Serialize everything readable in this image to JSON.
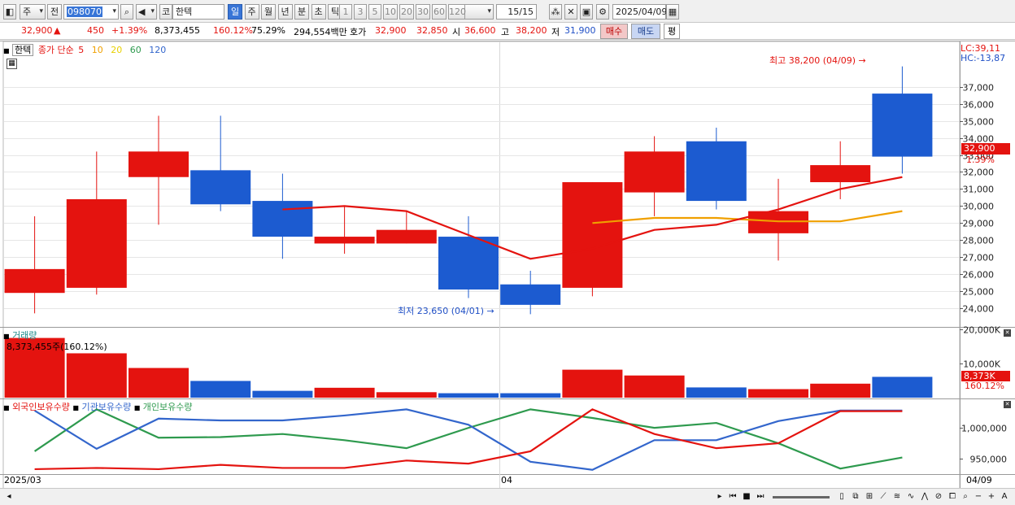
{
  "toolbar": {
    "market_type": "주",
    "prev_label": "전",
    "code": "098070",
    "code_prefix": "코",
    "stock_name": "한텍",
    "periods": [
      "일",
      "주",
      "월",
      "년",
      "분",
      "초",
      "틱"
    ],
    "selected_period": "일",
    "intervals": [
      "1",
      "3",
      "5",
      "10",
      "20",
      "30",
      "60",
      "120"
    ],
    "count": "15/15",
    "date": "2025/04/09"
  },
  "quote": {
    "price": "32,900",
    "change_arrow": "▲",
    "change": "450",
    "change_pct": "+1.39%",
    "volume": "8,373,455",
    "volume_ratio": "160.12%",
    "turnover": "75.29%",
    "amount": "294,554백만",
    "ask_label": "호가",
    "ask": "32,900",
    "bid": "32,850",
    "open_label": "시",
    "open": "36,600",
    "high_label": "고",
    "high": "38,200",
    "low_label": "저",
    "low": "31,900",
    "buy_label": "매수",
    "sell_label": "매도",
    "avg_label": "평"
  },
  "price_panel": {
    "stock_tag": "한텍",
    "ma_title": "종가 단순",
    "ma_periods": [
      "5",
      "10",
      "20",
      "60",
      "120"
    ],
    "ma_colors": [
      "#e4130f",
      "#f0a000",
      "#e8d000",
      "#2e9a4e",
      "#3366cc"
    ],
    "lc": "LC:39,11",
    "hc": "HC:-13,87",
    "price_tag": "32,900",
    "pct_tag": "1.39%",
    "high_note": "최고 38,200 (04/09)",
    "low_note": "최저 23,650 (04/01)"
  },
  "volume_panel": {
    "title": "거래량",
    "info": "8,373,455주(160.12%)",
    "tag": "8,373K",
    "tag_pct": "160.12%"
  },
  "holding_panel": {
    "titles": [
      "외국인보유수량",
      "기관보유수량",
      "개인보유수량"
    ],
    "colors": [
      "#e4130f",
      "#3366cc",
      "#2e9a4e"
    ]
  },
  "x_axis": {
    "start": "2025/03",
    "mid": "04",
    "end": "04/09"
  },
  "colors": {
    "up": "#e4130f",
    "down": "#1c5bd0",
    "ma5": "#e4130f",
    "ma10": "#f0a000"
  },
  "chart_data": [
    {
      "type": "candlestick",
      "candles": [
        {
          "open": 24900,
          "close": 26300,
          "high": 29400,
          "low": 23700
        },
        {
          "open": 25200,
          "close": 30400,
          "high": 33200,
          "low": 24800
        },
        {
          "open": 31700,
          "close": 33200,
          "high": 35300,
          "low": 28900
        },
        {
          "open": 32100,
          "close": 30100,
          "high": 35300,
          "low": 29700
        },
        {
          "open": 30300,
          "close": 28200,
          "high": 31900,
          "low": 26900
        },
        {
          "open": 27800,
          "close": 28200,
          "high": 30000,
          "low": 27200
        },
        {
          "open": 27800,
          "close": 28600,
          "high": 29700,
          "low": 27800
        },
        {
          "open": 28200,
          "close": 25100,
          "high": 29400,
          "low": 24600
        },
        {
          "open": 25400,
          "close": 24200,
          "high": 26200,
          "low": 23650
        },
        {
          "open": 25200,
          "close": 31400,
          "high": 31400,
          "low": 24700
        },
        {
          "open": 30800,
          "close": 33200,
          "high": 34100,
          "low": 29400
        },
        {
          "open": 33800,
          "close": 30300,
          "high": 34600,
          "low": 29800
        },
        {
          "open": 28400,
          "close": 29700,
          "high": 31600,
          "low": 26800
        },
        {
          "open": 31400,
          "close": 32400,
          "high": 33800,
          "low": 30400
        },
        {
          "open": 36600,
          "close": 32900,
          "high": 38200,
          "low": 31900
        }
      ],
      "ma5": [
        null,
        null,
        null,
        null,
        29800,
        30000,
        29700,
        28300,
        26900,
        27500,
        28600,
        28900,
        29800,
        31000,
        31700
      ],
      "ma10": [
        null,
        null,
        null,
        null,
        null,
        null,
        null,
        null,
        null,
        29000,
        29300,
        29300,
        29100,
        29100,
        29700
      ],
      "y_ticks": [
        24000,
        25000,
        26000,
        27000,
        28000,
        29000,
        30000,
        31000,
        32000,
        33000,
        34000,
        35000,
        36000,
        37000
      ],
      "ylim": [
        23000,
        38800
      ]
    },
    {
      "type": "bar",
      "title": "거래량",
      "values": [
        17500,
        13000,
        8700,
        4900,
        2000,
        2900,
        1600,
        1300,
        1300,
        8200,
        6500,
        3000,
        2500,
        4100,
        6100
      ],
      "y_ticks": [
        10000,
        20000
      ],
      "ylim": [
        0,
        20500
      ]
    },
    {
      "type": "line",
      "series": [
        {
          "name": "외국인보유수량",
          "values": [
            933000,
            935000,
            933000,
            940000,
            935000,
            935000,
            947000,
            942000,
            962000,
            1030000,
            990000,
            967000,
            975000,
            1027000,
            1027000
          ]
        },
        {
          "name": "기관보유수량",
          "values": [
            1028000,
            966000,
            1015000,
            1012000,
            1012000,
            1020000,
            1030000,
            1005000,
            945000,
            932000,
            980000,
            980000,
            1011000,
            1028000,
            1028000
          ]
        },
        {
          "name": "개인보유수량",
          "values": [
            962000,
            1030000,
            984000,
            985000,
            990000,
            980000,
            967000,
            1000000,
            1030000,
            1016000,
            1000000,
            1008000,
            975000,
            934000,
            952000
          ]
        }
      ],
      "y_ticks": [
        950000,
        1000000
      ],
      "ylim": [
        925000,
        1045000
      ]
    }
  ]
}
